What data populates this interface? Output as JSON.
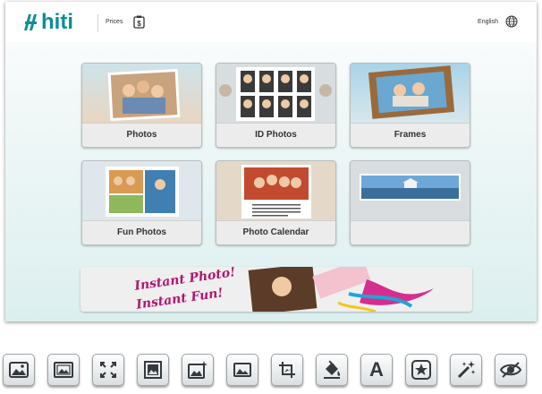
{
  "header": {
    "logo_text": "hiti",
    "prices_label": "Prices",
    "price_icon": "dollar-tag-icon",
    "language_label": "English",
    "language_icon": "globe-icon"
  },
  "tiles": [
    {
      "label": "Photos"
    },
    {
      "label": "ID Photos"
    },
    {
      "label": "Frames"
    },
    {
      "label": "Fun Photos"
    },
    {
      "label": "Photo Calendar"
    },
    {
      "label": ""
    }
  ],
  "banner": {
    "line1": "Instant Photo!",
    "line2": "Instant Fun!"
  },
  "toolbar": {
    "icons": [
      "image-icon",
      "image-frame-icon",
      "fullscreen-icon",
      "image-border-icon",
      "image-sparkle-icon",
      "image-small-icon",
      "crop-icon",
      "paint-bucket-icon",
      "text-icon",
      "star-sticker-icon",
      "magic-wand-icon",
      "red-eye-icon"
    ],
    "text_tool_letter": "A"
  },
  "colors": {
    "brand": "#0a8f93",
    "background": "#e3f2f2",
    "banner_text": "#b1156f"
  }
}
